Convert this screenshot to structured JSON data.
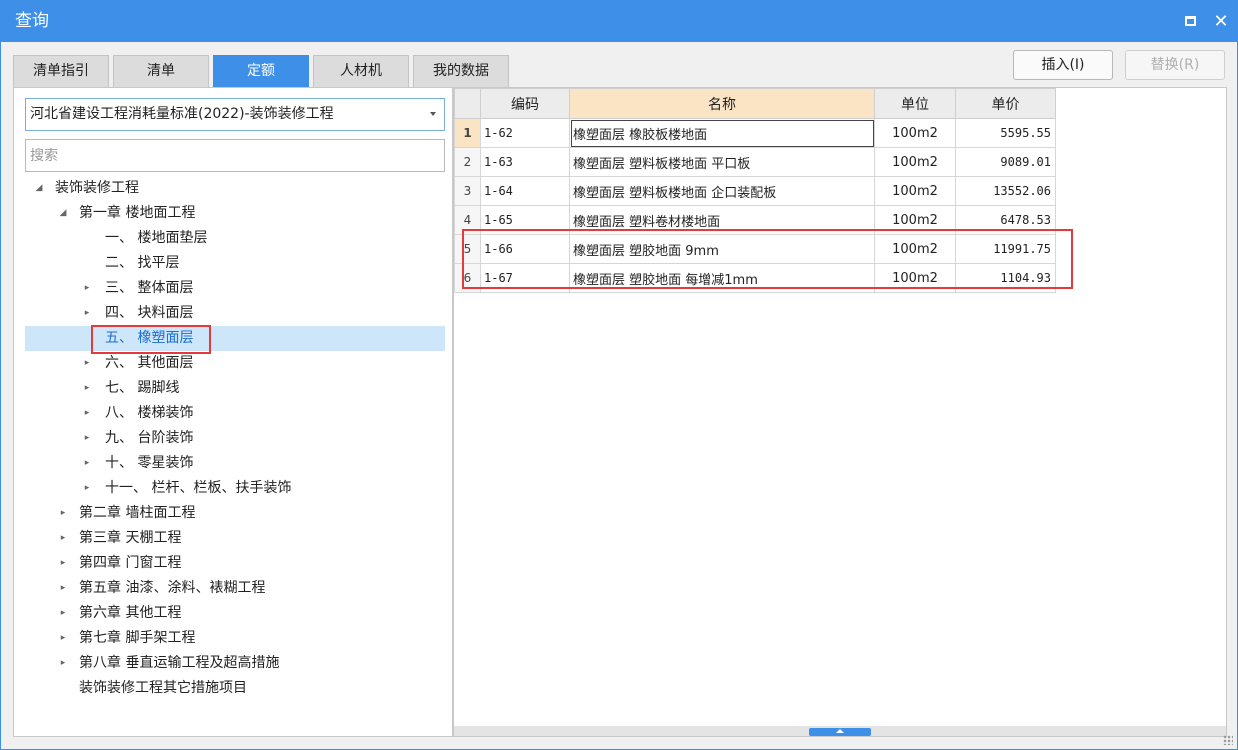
{
  "window": {
    "title": "查询",
    "close_glyph": "✕"
  },
  "tabs": [
    {
      "label": "清单指引",
      "active": false
    },
    {
      "label": "清单",
      "active": false
    },
    {
      "label": "定额",
      "active": true
    },
    {
      "label": "人材机",
      "active": false
    },
    {
      "label": "我的数据",
      "active": false
    }
  ],
  "toolbar": {
    "insert_label": "插入(I)",
    "replace_label": "替换(R)"
  },
  "left": {
    "standard_select": "河北省建设工程消耗量标准(2022)-装饰装修工程",
    "search_placeholder": "搜索"
  },
  "tree": [
    {
      "label": "装饰装修工程",
      "arrow": "◢",
      "depth": 0
    },
    {
      "label": "第一章 楼地面工程",
      "arrow": "◢",
      "depth": 1
    },
    {
      "label": "一、 楼地面垫层",
      "arrow": "",
      "depth": 2
    },
    {
      "label": "二、 找平层",
      "arrow": "",
      "depth": 2
    },
    {
      "label": "三、 整体面层",
      "arrow": "▸",
      "depth": 2
    },
    {
      "label": "四、 块料面层",
      "arrow": "▸",
      "depth": 2
    },
    {
      "label": "五、 橡塑面层",
      "arrow": "",
      "depth": 2,
      "selected": true
    },
    {
      "label": "六、 其他面层",
      "arrow": "▸",
      "depth": 2
    },
    {
      "label": "七、 踢脚线",
      "arrow": "▸",
      "depth": 2
    },
    {
      "label": "八、 楼梯装饰",
      "arrow": "▸",
      "depth": 2
    },
    {
      "label": "九、 台阶装饰",
      "arrow": "▸",
      "depth": 2
    },
    {
      "label": "十、 零星装饰",
      "arrow": "▸",
      "depth": 2
    },
    {
      "label": "十一、 栏杆、栏板、扶手装饰",
      "arrow": "▸",
      "depth": 2
    },
    {
      "label": "第二章 墙柱面工程",
      "arrow": "▸",
      "depth": 1
    },
    {
      "label": "第三章 天棚工程",
      "arrow": "▸",
      "depth": 1
    },
    {
      "label": "第四章 门窗工程",
      "arrow": "▸",
      "depth": 1
    },
    {
      "label": "第五章 油漆、涂料、裱糊工程",
      "arrow": "▸",
      "depth": 1
    },
    {
      "label": "第六章 其他工程",
      "arrow": "▸",
      "depth": 1
    },
    {
      "label": "第七章 脚手架工程",
      "arrow": "▸",
      "depth": 1
    },
    {
      "label": "第八章 垂直运输工程及超高措施",
      "arrow": "▸",
      "depth": 1
    },
    {
      "label": "装饰装修工程其它措施项目",
      "arrow": "",
      "depth": 1
    }
  ],
  "grid": {
    "headers": {
      "code": "编码",
      "name": "名称",
      "unit": "单位",
      "price": "单价"
    },
    "rows": [
      {
        "idx": "1",
        "code": "1-62",
        "name": "橡塑面层 橡胶板楼地面",
        "unit": "100m2",
        "price": "5595.55"
      },
      {
        "idx": "2",
        "code": "1-63",
        "name": "橡塑面层 塑料板楼地面 平口板",
        "unit": "100m2",
        "price": "9089.01"
      },
      {
        "idx": "3",
        "code": "1-64",
        "name": "橡塑面层 塑料板楼地面 企口装配板",
        "unit": "100m2",
        "price": "13552.06"
      },
      {
        "idx": "4",
        "code": "1-65",
        "name": "橡塑面层 塑料卷材楼地面",
        "unit": "100m2",
        "price": "6478.53"
      },
      {
        "idx": "5",
        "code": "1-66",
        "name": "橡塑面层 塑胶地面 9mm",
        "unit": "100m2",
        "price": "11991.75"
      },
      {
        "idx": "6",
        "code": "1-67",
        "name": "橡塑面层 塑胶地面 每增减1mm",
        "unit": "100m2",
        "price": "1104.93"
      }
    ]
  }
}
